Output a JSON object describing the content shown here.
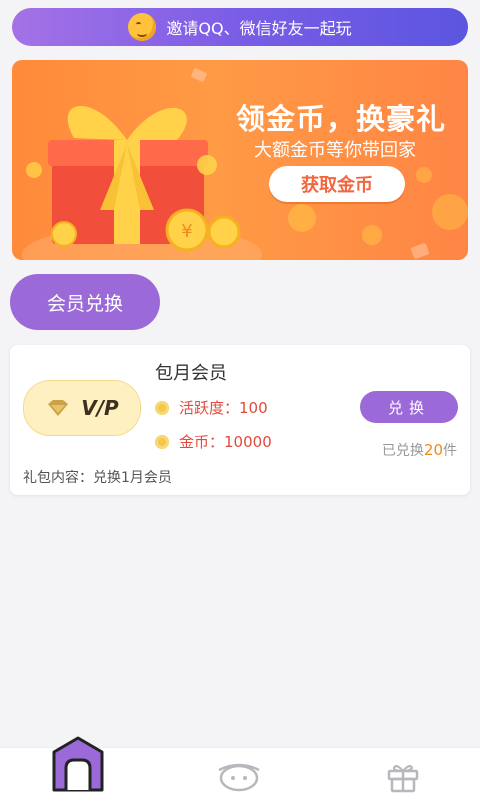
{
  "invite": {
    "text": "邀请QQ、微信好友一起玩"
  },
  "banner": {
    "title": "领金币，换豪礼",
    "subtitle": "大额金币等你带回家",
    "button": "获取金币"
  },
  "section": {
    "tab_label": "会员兑换"
  },
  "card": {
    "name": "包月会员",
    "badge_text": "V/P",
    "activity_label": "活跃度：",
    "activity_value": "100",
    "coin_label": "金币：",
    "coin_value": "10000",
    "button": "兑换",
    "redeemed_prefix": "已兑换",
    "redeemed_count": "20",
    "redeemed_suffix": "件",
    "gift_label": "礼包内容：",
    "gift_content": "兑换1月会员"
  },
  "nav": {
    "items": [
      "home-icon",
      "chat-icon",
      "gift-icon"
    ],
    "active": 0
  },
  "colors": {
    "accent": "#9b6ad8",
    "banner": "#ff8a3a",
    "highlight": "#f08a1c",
    "value": "#e24a3d"
  }
}
